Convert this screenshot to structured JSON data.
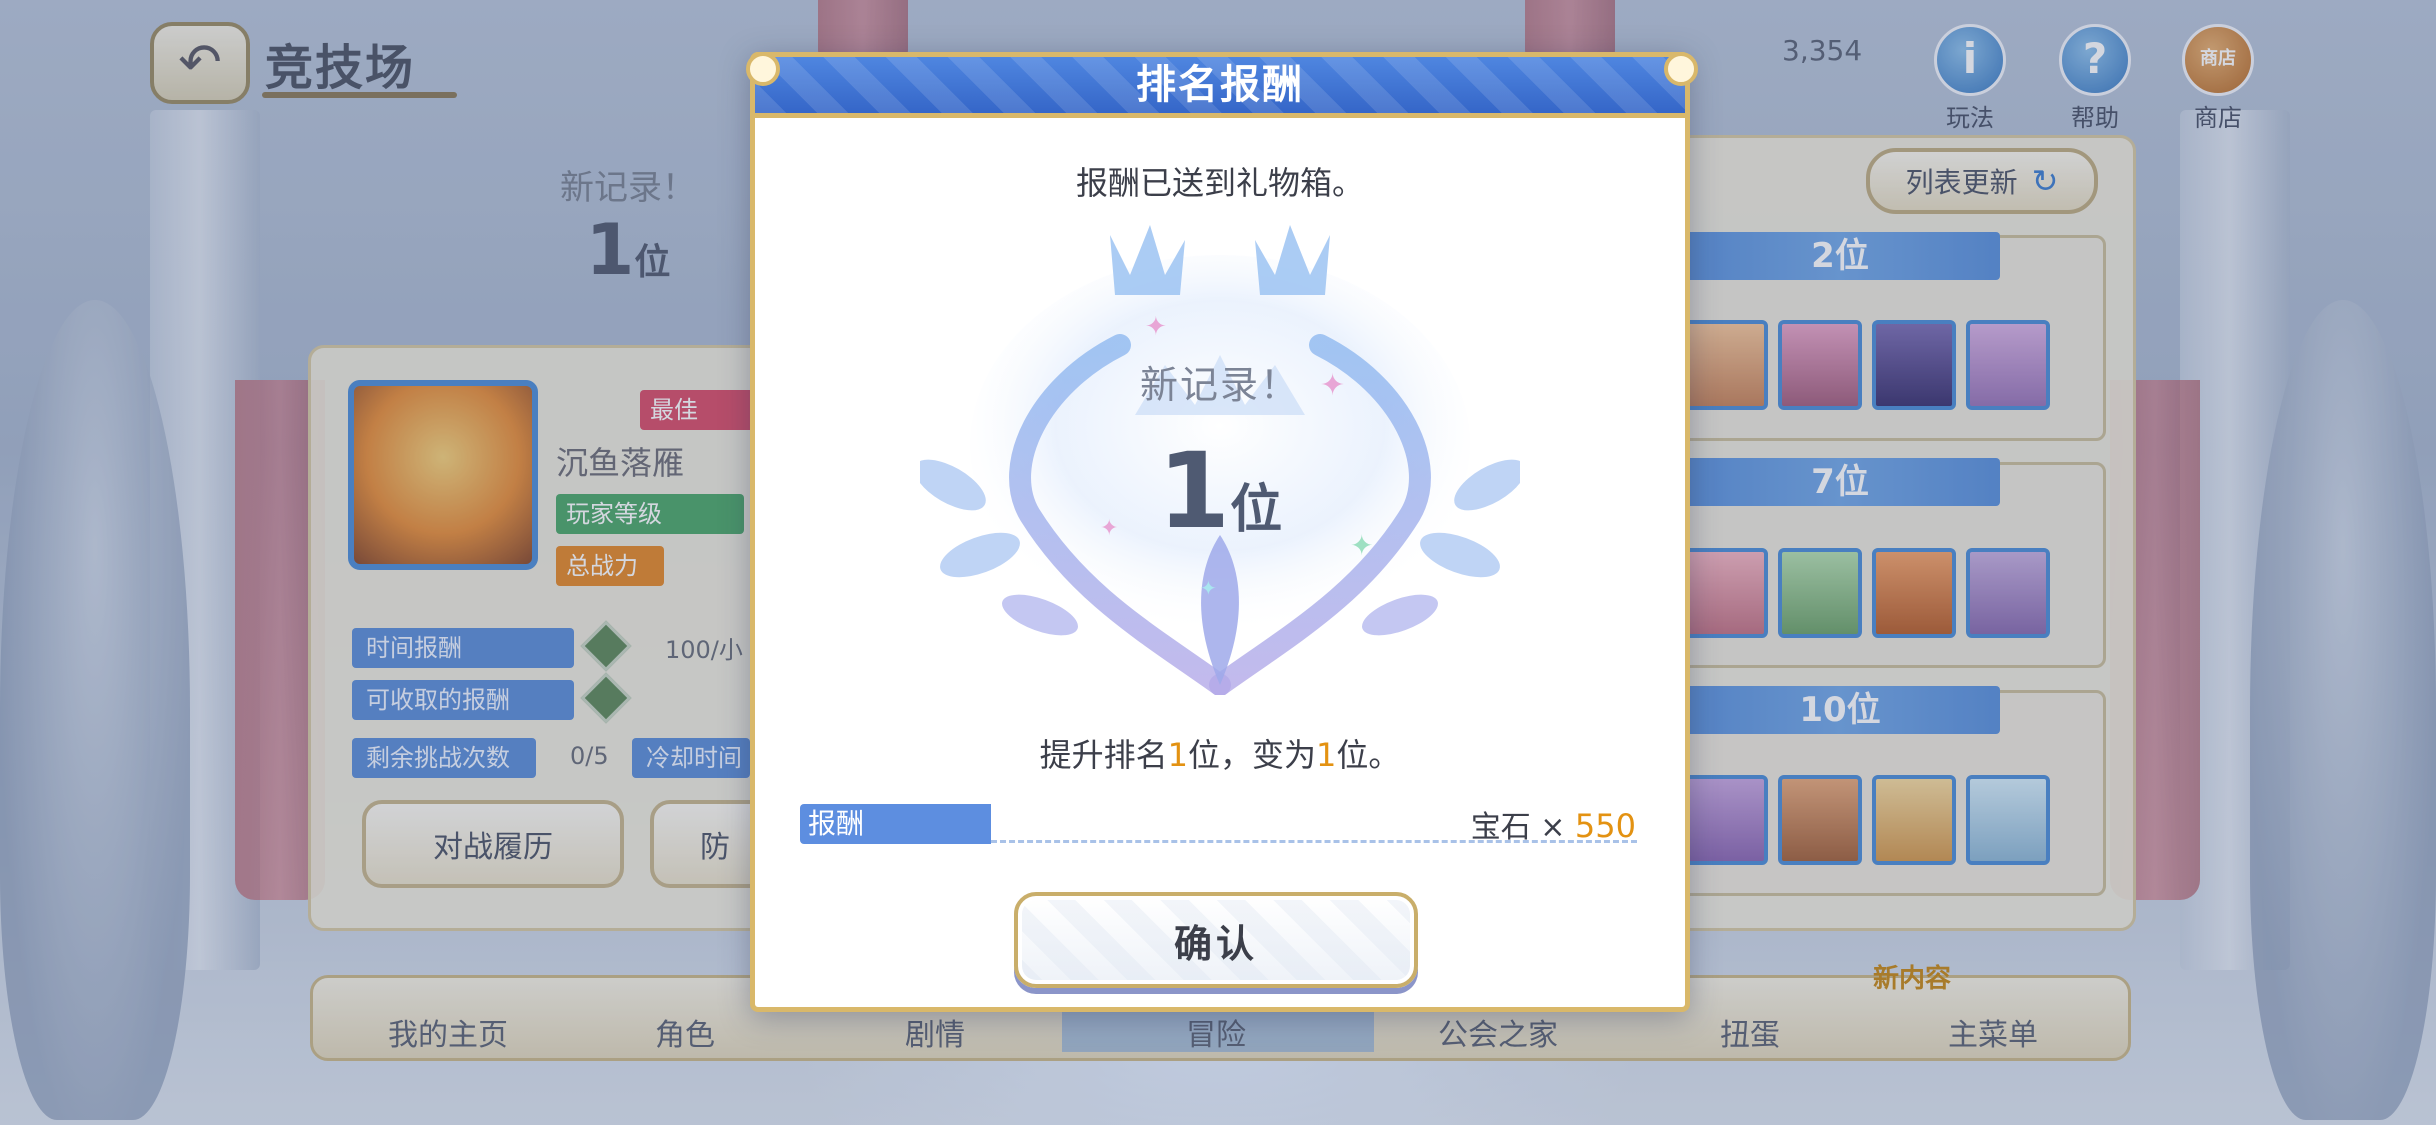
{
  "background": {
    "screen_title": "竞技场",
    "gem_count": "3,354",
    "top_icons": [
      {
        "label": "玩法",
        "glyph": "i"
      },
      {
        "label": "帮助",
        "glyph": "?"
      },
      {
        "label": "商店",
        "glyph": "商店"
      }
    ],
    "emblem": {
      "new_record": "新记录！",
      "rank_num": "1",
      "rank_suffix": "位"
    },
    "player": {
      "name": "沉鱼落雁",
      "badge": "最佳",
      "level_label": "玩家等级",
      "power_label": "总战力"
    },
    "stats": [
      {
        "label": "时间报酬",
        "value": "100/小"
      },
      {
        "label": "可收取的报酬",
        "value": ""
      },
      {
        "label": "剩余挑战次数",
        "value": "0/5",
        "extra": "冷却时间"
      }
    ],
    "buttons": {
      "history": "对战履历",
      "defense": "防"
    },
    "refresh_label": "列表更新",
    "ranks": [
      "2位",
      "7位",
      "10位"
    ],
    "bottom_nav": [
      "我的主页",
      "角色",
      "剧情",
      "冒险",
      "公会之家",
      "扭蛋",
      "主菜单"
    ],
    "new_content": "新内容"
  },
  "modal": {
    "title": "排名报酬",
    "message": "报酬已送到礼物箱。",
    "crest_title": "新记录！",
    "crest_rank_num": "1",
    "crest_rank_suffix": "位",
    "promo_prefix": "提升排名",
    "promo_up": "1",
    "promo_mid": "位，变为",
    "promo_new": "1",
    "promo_suffix": "位。",
    "reward_label": "报酬",
    "reward_item": "宝石 × ",
    "reward_amount": "550",
    "confirm_label": "确认"
  },
  "colors": {
    "header_blue": "#3f74d4",
    "accent_orange": "#e39212",
    "gold_border": "#d9b86a",
    "reward_label_blue": "#5d8ee0"
  }
}
